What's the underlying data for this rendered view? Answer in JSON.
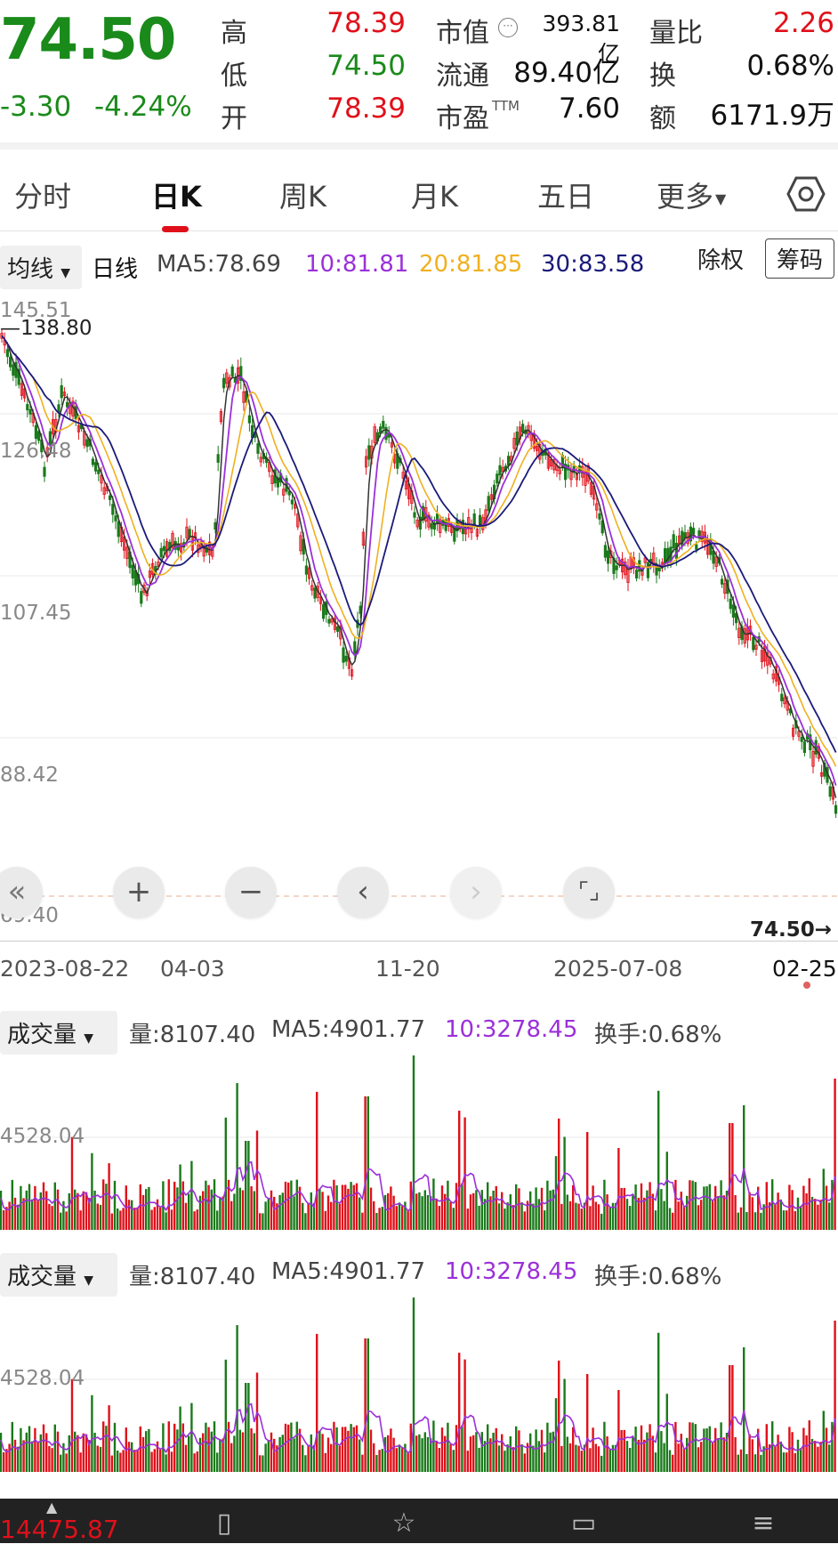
{
  "quote": {
    "price": "74.50",
    "change": "-3.30",
    "change_pct": "-4.24%",
    "high_label": "高",
    "high": "78.39",
    "low_label": "低",
    "low": "74.50",
    "open_label": "开",
    "open": "78.39",
    "mktcap_label": "市值",
    "mktcap": "393.81亿",
    "float_label": "流通",
    "float": "89.40亿",
    "pe_label": "市盈",
    "pe_suffix": "TTM",
    "pe": "7.60",
    "volratio_label": "量比",
    "volratio": "2.26",
    "turnover_label": "换",
    "turnover": "0.68%",
    "amount_label": "额",
    "amount": "6171.9万"
  },
  "tabs": [
    "分时",
    "日K",
    "周K",
    "月K",
    "五日",
    "更多"
  ],
  "active_tab": 1,
  "ma_bar": {
    "indicator_select": "均线",
    "period": "日线",
    "ma5": "MA5:78.69",
    "ma10": "10:81.81",
    "ma20": "20:81.85",
    "ma30": "30:83.58",
    "fuquan": "除权",
    "chip": "筹码"
  },
  "price_axis": {
    "labels": [
      "145.51",
      "126.48",
      "107.45",
      "88.42",
      "69.40"
    ],
    "high_marker": "138.80",
    "last_marker": "74.50→"
  },
  "dates": [
    "2023-08-22",
    "04-03",
    "11-20",
    "2025-07-08",
    "02-25"
  ],
  "volume_panels": [
    {
      "select": "成交量",
      "vol": "量:8107.40",
      "ma5": "MA5:4901.77",
      "ma10": "10:3278.45",
      "turnover": "换手:0.68%",
      "axis": "4528.04"
    },
    {
      "select": "成交量",
      "vol": "量:8107.40",
      "ma5": "MA5:4901.77",
      "ma10": "10:3278.45",
      "turnover": "换手:0.68%",
      "axis": "4528.04"
    }
  ],
  "index_bottom": "14475.87",
  "colors": {
    "up": "#e0101a",
    "down": "#1a7a1a",
    "ma5": "#333333",
    "ma10": "#9b30d9",
    "ma20": "#f0b020",
    "ma30": "#1a1a7a",
    "accent": "#e0101a"
  },
  "icons": [
    "settings-hex-icon",
    "rewind-icon",
    "zoom-in-icon",
    "zoom-out-icon",
    "prev-icon",
    "next-icon",
    "fullscreen-icon",
    "dropdown-caret-icon"
  ]
}
